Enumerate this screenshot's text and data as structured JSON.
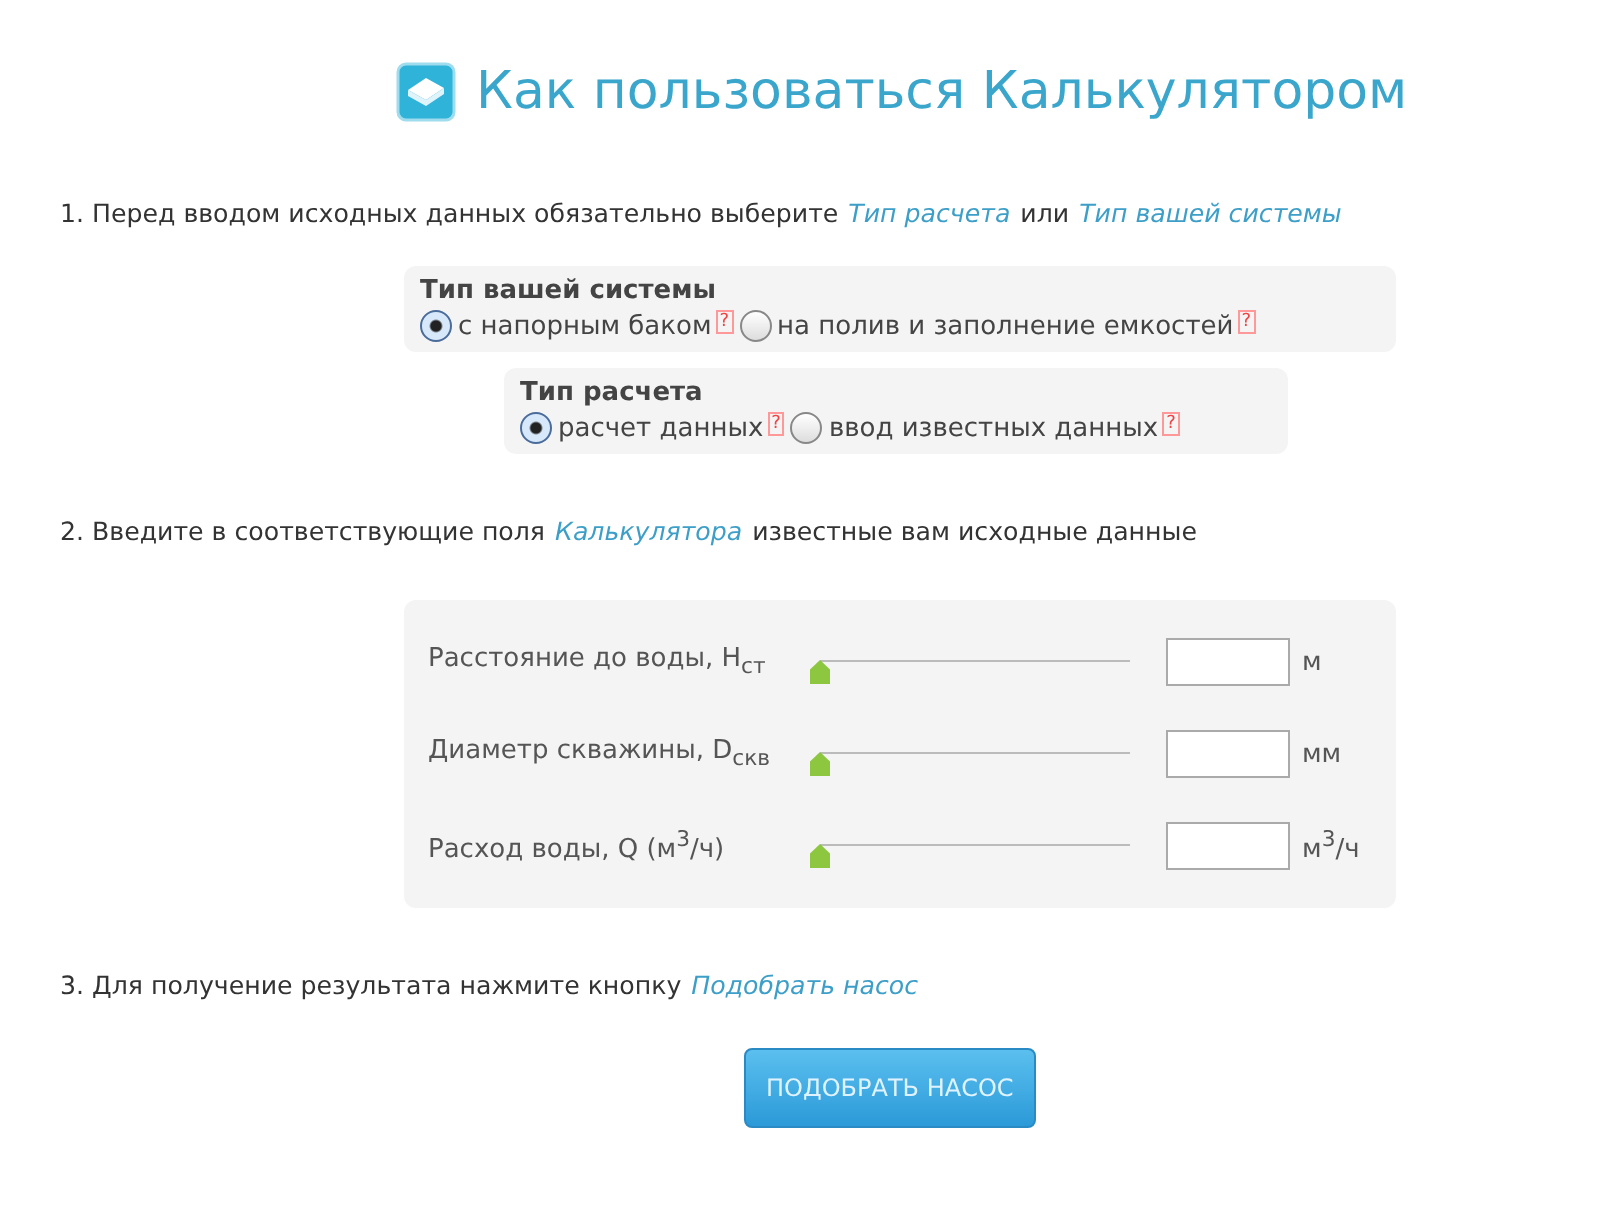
{
  "title": "Как пользоваться Калькулятором",
  "step1": [
    {
      "kind": "text",
      "text": "1. Перед вводом исходных данных обязательно выберите"
    },
    {
      "kind": "link",
      "text": "Тип расчета"
    },
    {
      "kind": "text",
      "text": "или"
    },
    {
      "kind": "link",
      "text": "Тип вашей системы"
    }
  ],
  "system_type": {
    "title": "Тип вашей системы",
    "options": [
      {
        "label": "с напорным баком",
        "help": "?",
        "selected": true
      },
      {
        "label": "на полив и заполнение емкостей",
        "help": "?",
        "selected": false
      }
    ]
  },
  "calc_type": {
    "title": "Тип расчета",
    "options": [
      {
        "label": "расчет данных",
        "help": "?",
        "selected": true
      },
      {
        "label": "ввод известных данных",
        "help": "?",
        "selected": false
      }
    ]
  },
  "step2": [
    {
      "kind": "text",
      "text": "2. Введите в соответствующие поля"
    },
    {
      "kind": "link",
      "text": "Калькулятора"
    },
    {
      "kind": "text",
      "text": "известные вам исходные данные"
    }
  ],
  "inputs": [
    {
      "label": "Расстояние до воды, H$_{ст}$",
      "level": 0,
      "unit": "м"
    },
    {
      "label": "Диаметр скважины, D$_{скв}$",
      "level": 0,
      "unit": "мм"
    },
    {
      "label": "Расход воды, Q (м$^{3}$/ч)",
      "level": 0,
      "unit": "м$^{3}$/ч"
    }
  ],
  "step3": [
    {
      "kind": "text",
      "text": "3. Для получение результата нажмите кнопку"
    },
    {
      "kind": "link",
      "text": "Подобрать насос"
    }
  ],
  "button": "ПОДОБРАТЬ НАСОС"
}
